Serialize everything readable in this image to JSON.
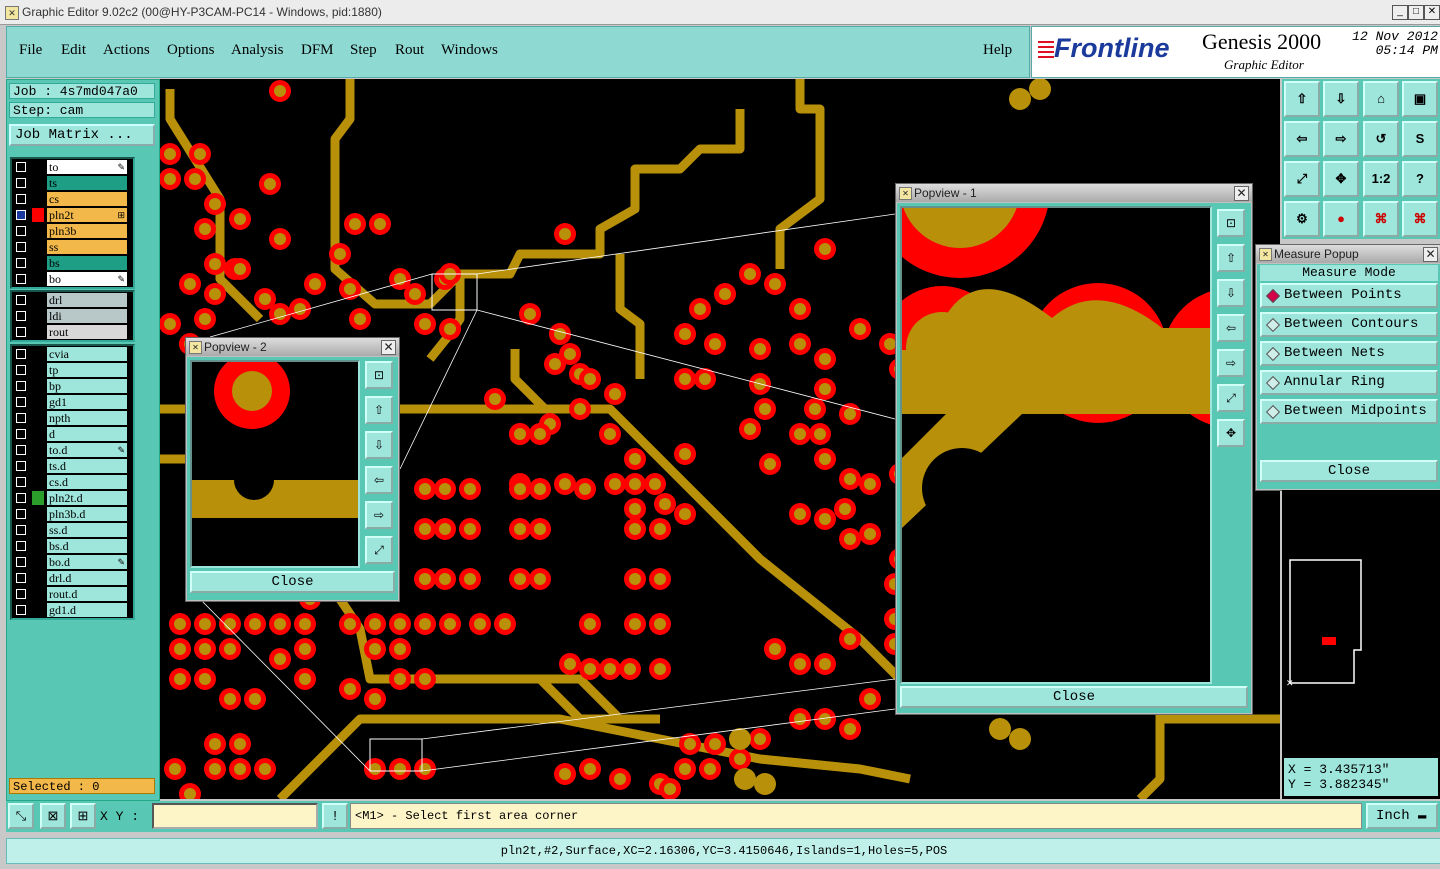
{
  "window": {
    "title": "Graphic Editor 9.02c2 (00@HY-P3CAM-PC14 - Windows, pid:1880)"
  },
  "menu": [
    "File",
    "Edit",
    "Actions",
    "Options",
    "Analysis",
    "DFM",
    "Step",
    "Rout",
    "Windows"
  ],
  "help_label": "Help",
  "brand": {
    "logo": "Frontline",
    "product": "Genesis 2000",
    "subtitle": "Graphic Editor",
    "date": "12 Nov 2012",
    "time": "05:14 PM"
  },
  "job": {
    "job_label": "Job : 4s7md047a0",
    "step_label": "Step: cam",
    "job_matrix": "Job Matrix ..."
  },
  "layers_group1": [
    {
      "name": "to",
      "color": "#ffffff",
      "mark": "✎"
    },
    {
      "name": "ts",
      "color": "#1f9e86",
      "mark": ""
    },
    {
      "name": "cs",
      "color": "#f2b84a",
      "mark": ""
    },
    {
      "name": "pln2t",
      "color": "#f2b84a",
      "mark": "⊞",
      "active": true
    },
    {
      "name": "pln3b",
      "color": "#f2b84a",
      "mark": ""
    },
    {
      "name": "ss",
      "color": "#f2b84a",
      "mark": ""
    },
    {
      "name": "bs",
      "color": "#1f9e86",
      "mark": ""
    },
    {
      "name": "bo",
      "color": "#ffffff",
      "mark": "✎"
    }
  ],
  "layers_group2": [
    {
      "name": "drl",
      "color": "#b8c8c8",
      "mark": ""
    },
    {
      "name": "ldi",
      "color": "#b8c8c8",
      "mark": ""
    },
    {
      "name": "rout",
      "color": "#d8d8d8",
      "mark": ""
    }
  ],
  "layers_group3": [
    {
      "name": "cvia",
      "mark": ""
    },
    {
      "name": "tp",
      "mark": ""
    },
    {
      "name": "bp",
      "mark": ""
    },
    {
      "name": "gd1",
      "mark": ""
    },
    {
      "name": "npth",
      "mark": ""
    },
    {
      "name": "d",
      "mark": ""
    },
    {
      "name": "to.d",
      "mark": "✎"
    },
    {
      "name": "ts.d",
      "mark": ""
    },
    {
      "name": "cs.d",
      "mark": ""
    },
    {
      "name": "pln2t.d",
      "mark": "",
      "swatch": "#2a9d2a"
    },
    {
      "name": "pln3b.d",
      "mark": ""
    },
    {
      "name": "ss.d",
      "mark": ""
    },
    {
      "name": "bs.d",
      "mark": ""
    },
    {
      "name": "bo.d",
      "mark": "✎"
    },
    {
      "name": "drl.d",
      "mark": ""
    },
    {
      "name": "rout.d",
      "mark": ""
    },
    {
      "name": "gd1.d",
      "mark": ""
    }
  ],
  "selected": "Selected : 0",
  "popview1": {
    "title": "Popview - 1",
    "close": "Close"
  },
  "popview2": {
    "title": "Popview - 2",
    "close": "Close"
  },
  "measure": {
    "title": "Measure Popup",
    "heading": "Measure Mode",
    "options": [
      "Between Points",
      "Between Contours",
      "Between Nets",
      "Annular Ring",
      "Between Midpoints"
    ],
    "selected_index": 0,
    "close": "Close"
  },
  "coords": {
    "x": "X = 3.435713\"",
    "y": "Y = 3.882345\""
  },
  "command": {
    "xy_label": "X Y :",
    "xy_value": "",
    "prompt": "<M1> - Select first area corner",
    "units": "Inch"
  },
  "status": "pln2t,#2,Surface,XC=2.16306,YC=3.4150646,Islands=1,Holes=5,POS",
  "toolbar_labels": {
    "one_to_two": "1:2",
    "question": "?"
  },
  "colors": {
    "copper": "#b8900a",
    "pad_ring": "#ff0000",
    "background": "#000000",
    "panel": "#58c7b4",
    "button": "#9ee5db"
  }
}
